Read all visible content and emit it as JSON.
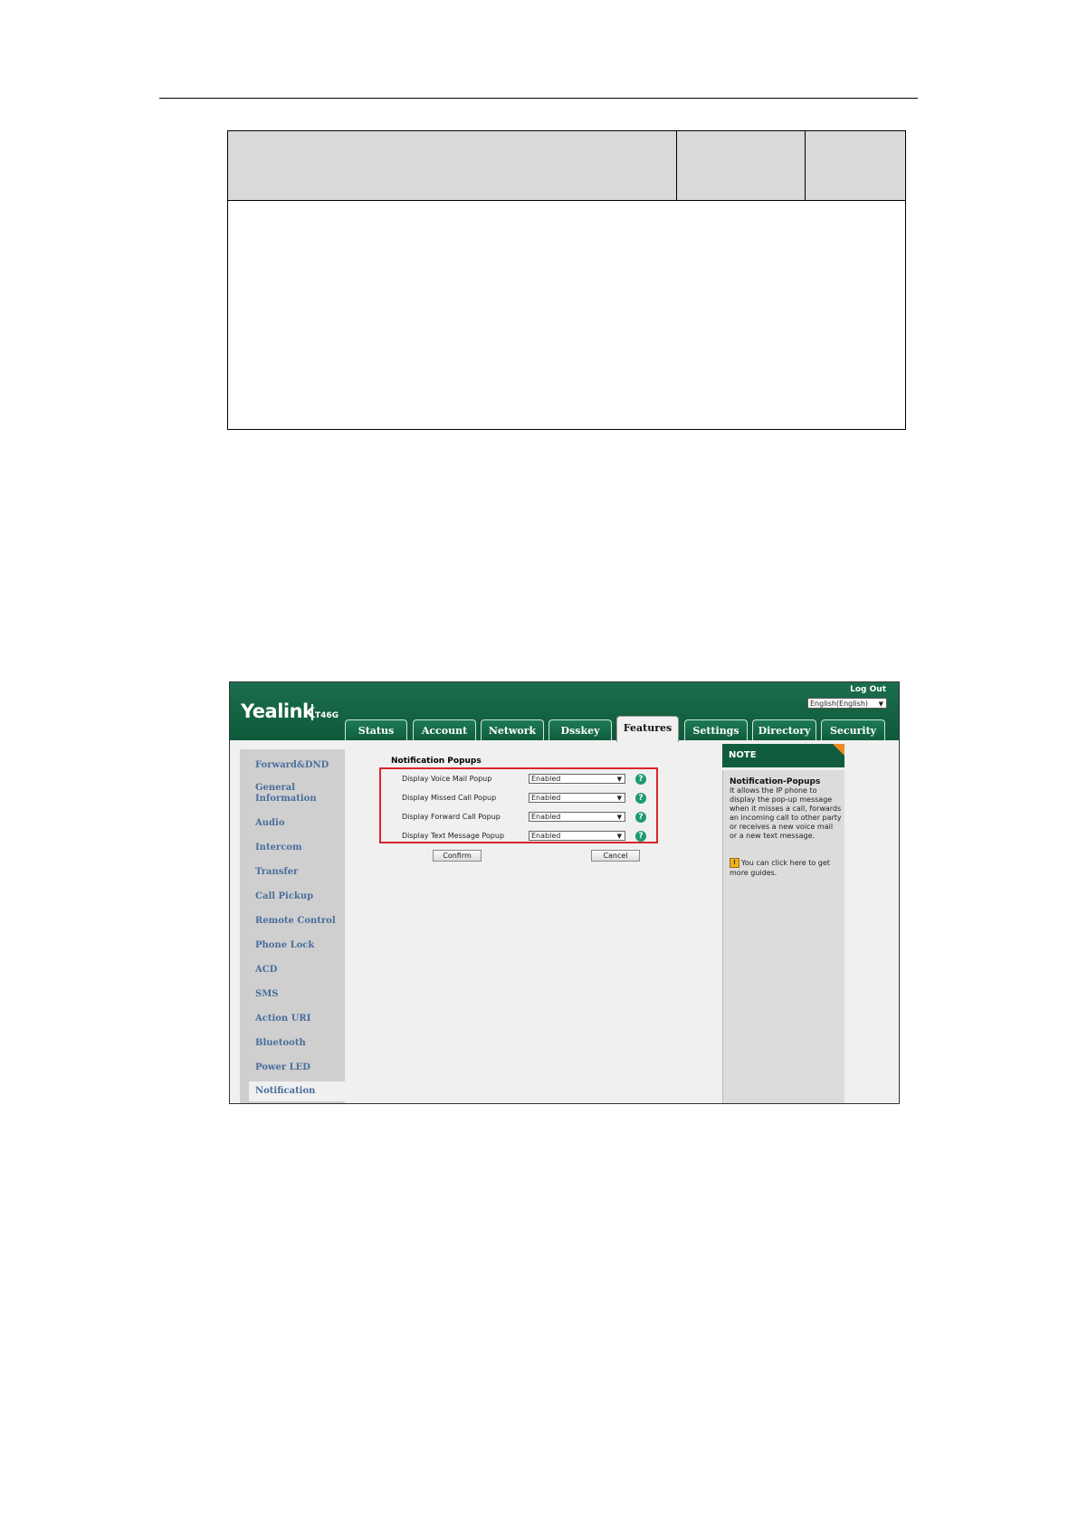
{
  "document": {},
  "screenshot": {
    "logo": "Yealink",
    "model": "T46G",
    "logout": "Log Out",
    "language": "English(English)",
    "tabs": [
      {
        "label": "Status"
      },
      {
        "label": "Account"
      },
      {
        "label": "Network"
      },
      {
        "label": "Dsskey"
      },
      {
        "label": "Features",
        "active": true
      },
      {
        "label": "Settings"
      },
      {
        "label": "Directory"
      },
      {
        "label": "Security"
      }
    ],
    "sidebar": {
      "items": [
        {
          "label": "Forward&DND"
        },
        {
          "label": "General Information"
        },
        {
          "label": "Audio"
        },
        {
          "label": "Intercom"
        },
        {
          "label": "Transfer"
        },
        {
          "label": "Call Pickup"
        },
        {
          "label": "Remote Control"
        },
        {
          "label": "Phone Lock"
        },
        {
          "label": "ACD"
        },
        {
          "label": "SMS"
        },
        {
          "label": "Action URI"
        },
        {
          "label": "Bluetooth"
        },
        {
          "label": "Power LED"
        },
        {
          "label": "Notification Popups",
          "active": true
        }
      ]
    },
    "section_title": "Notification Popups",
    "rows": [
      {
        "label": "Display Voice Mail Popup",
        "value": "Enabled"
      },
      {
        "label": "Display Missed Call Popup",
        "value": "Enabled"
      },
      {
        "label": "Display Forward Call Popup",
        "value": "Enabled"
      },
      {
        "label": "Display Text Message Popup",
        "value": "Enabled"
      }
    ],
    "help_glyph": "?",
    "confirm_label": "Confirm",
    "cancel_label": "Cancel",
    "note": {
      "header": "NOTE",
      "title": "Notification-Popups",
      "text": "It allows the IP phone to display the pop-up message when it misses a call, forwards an incoming call to other party or receives a new voice mail or a new text message.",
      "guide": "You can click here to get more guides."
    },
    "colors": {
      "brand_green": "#0f5d3e",
      "highlight_box": "#d9262b",
      "help_icon": "#1e9a70",
      "note_corner": "#f08a1f"
    }
  }
}
